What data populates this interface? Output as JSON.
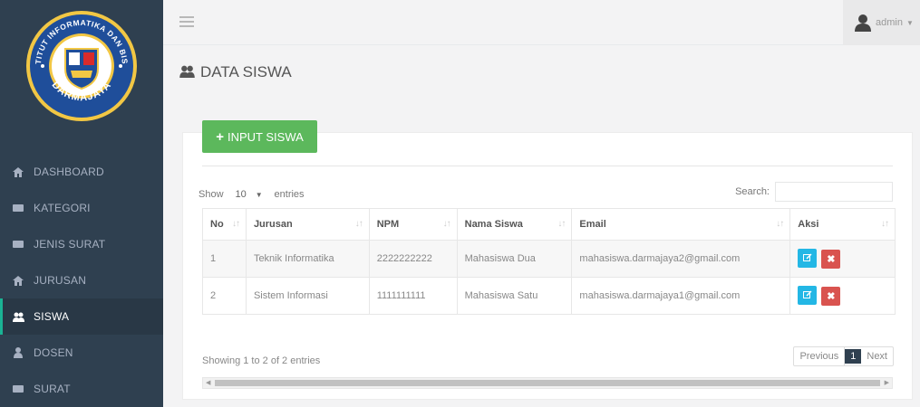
{
  "logo": {
    "top_text": "INSTITUT INFORMATIKA DAN BISNIS",
    "bottom_text": "DARMAJAYA"
  },
  "sidebar": {
    "items": [
      {
        "label": "DASHBOARD",
        "icon": "home-icon"
      },
      {
        "label": "KATEGORI",
        "icon": "card-icon"
      },
      {
        "label": "JENIS SURAT",
        "icon": "card-icon"
      },
      {
        "label": "JURUSAN",
        "icon": "home-icon"
      },
      {
        "label": "SISWA",
        "icon": "users-icon",
        "active": true
      },
      {
        "label": "DOSEN",
        "icon": "user-icon"
      },
      {
        "label": "SURAT",
        "icon": "card-icon"
      }
    ]
  },
  "topbar": {
    "user": "admin"
  },
  "page": {
    "title": "DATA SISWA"
  },
  "panel": {
    "input_button": "INPUT SISWA",
    "show_label": "Show",
    "entries_value": "10",
    "entries_label": "entries",
    "search_label": "Search:",
    "search_value": "",
    "columns": [
      "No",
      "Jurusan",
      "NPM",
      "Nama Siswa",
      "Email",
      "Aksi"
    ],
    "rows": [
      {
        "no": "1",
        "jurusan": "Teknik Informatika",
        "npm": "2222222222",
        "nama": "Mahasiswa Dua",
        "email": "mahasiswa.darmajaya2@gmail.com"
      },
      {
        "no": "2",
        "jurusan": "Sistem Informasi",
        "npm": "1111111111",
        "nama": "Mahasiswa Satu",
        "email": "mahasiswa.darmajaya1@gmail.com"
      }
    ],
    "info": "Showing 1 to 2 of 2 entries",
    "pagination": {
      "previous": "Previous",
      "current": "1",
      "next": "Next"
    }
  },
  "colors": {
    "sidebar_bg": "#2f4050",
    "active_accent": "#1ab394",
    "input_button": "#5cb85c",
    "edit_button": "#23b7e5",
    "delete_button": "#d9534f"
  }
}
